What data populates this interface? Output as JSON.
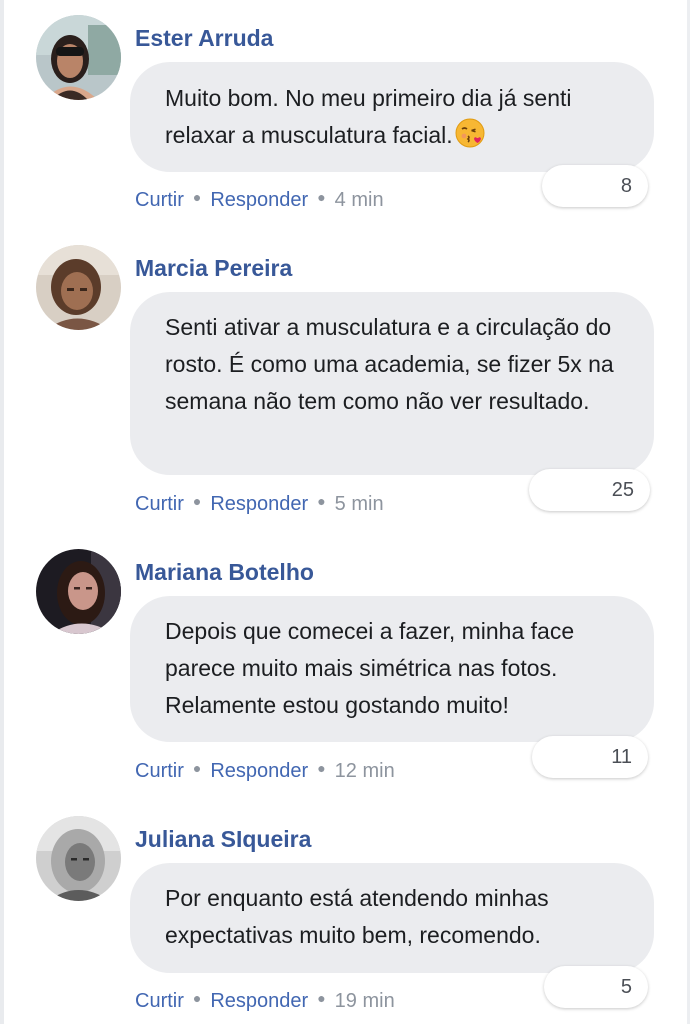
{
  "comments": [
    {
      "author": "Ester Arruda",
      "text": "Muito bom. No meu primeiro dia já senti relaxar a musculatura facial.",
      "emoji": "kissing-heart-emoji",
      "reaction_count": "8",
      "like_label": "Curtir",
      "reply_label": "Responder",
      "time": "4 min"
    },
    {
      "author": "Marcia Pereira",
      "text": "Senti ativar a musculatura e a circulação do rosto. É como uma academia, se fizer 5x na semana não tem como não ver resultado.",
      "reaction_count": "25",
      "like_label": "Curtir",
      "reply_label": "Responder",
      "time": "5 min"
    },
    {
      "author": "Mariana Botelho",
      "text": "Depois que comecei a fazer, minha face parece muito mais simétrica nas fotos. Relamente estou gostando muito!",
      "reaction_count": "11",
      "like_label": "Curtir",
      "reply_label": "Responder",
      "time": "12 min"
    },
    {
      "author": "Juliana SIqueira",
      "text": "Por enquanto está atendendo minhas expectativas muito bem, recomendo.",
      "reaction_count": "5",
      "like_label": "Curtir",
      "reply_label": "Responder",
      "time": "19 min"
    }
  ],
  "colors": {
    "author": "#385898",
    "link": "#4267b2",
    "bubble": "#ebecef",
    "meta": "#8d949e"
  }
}
